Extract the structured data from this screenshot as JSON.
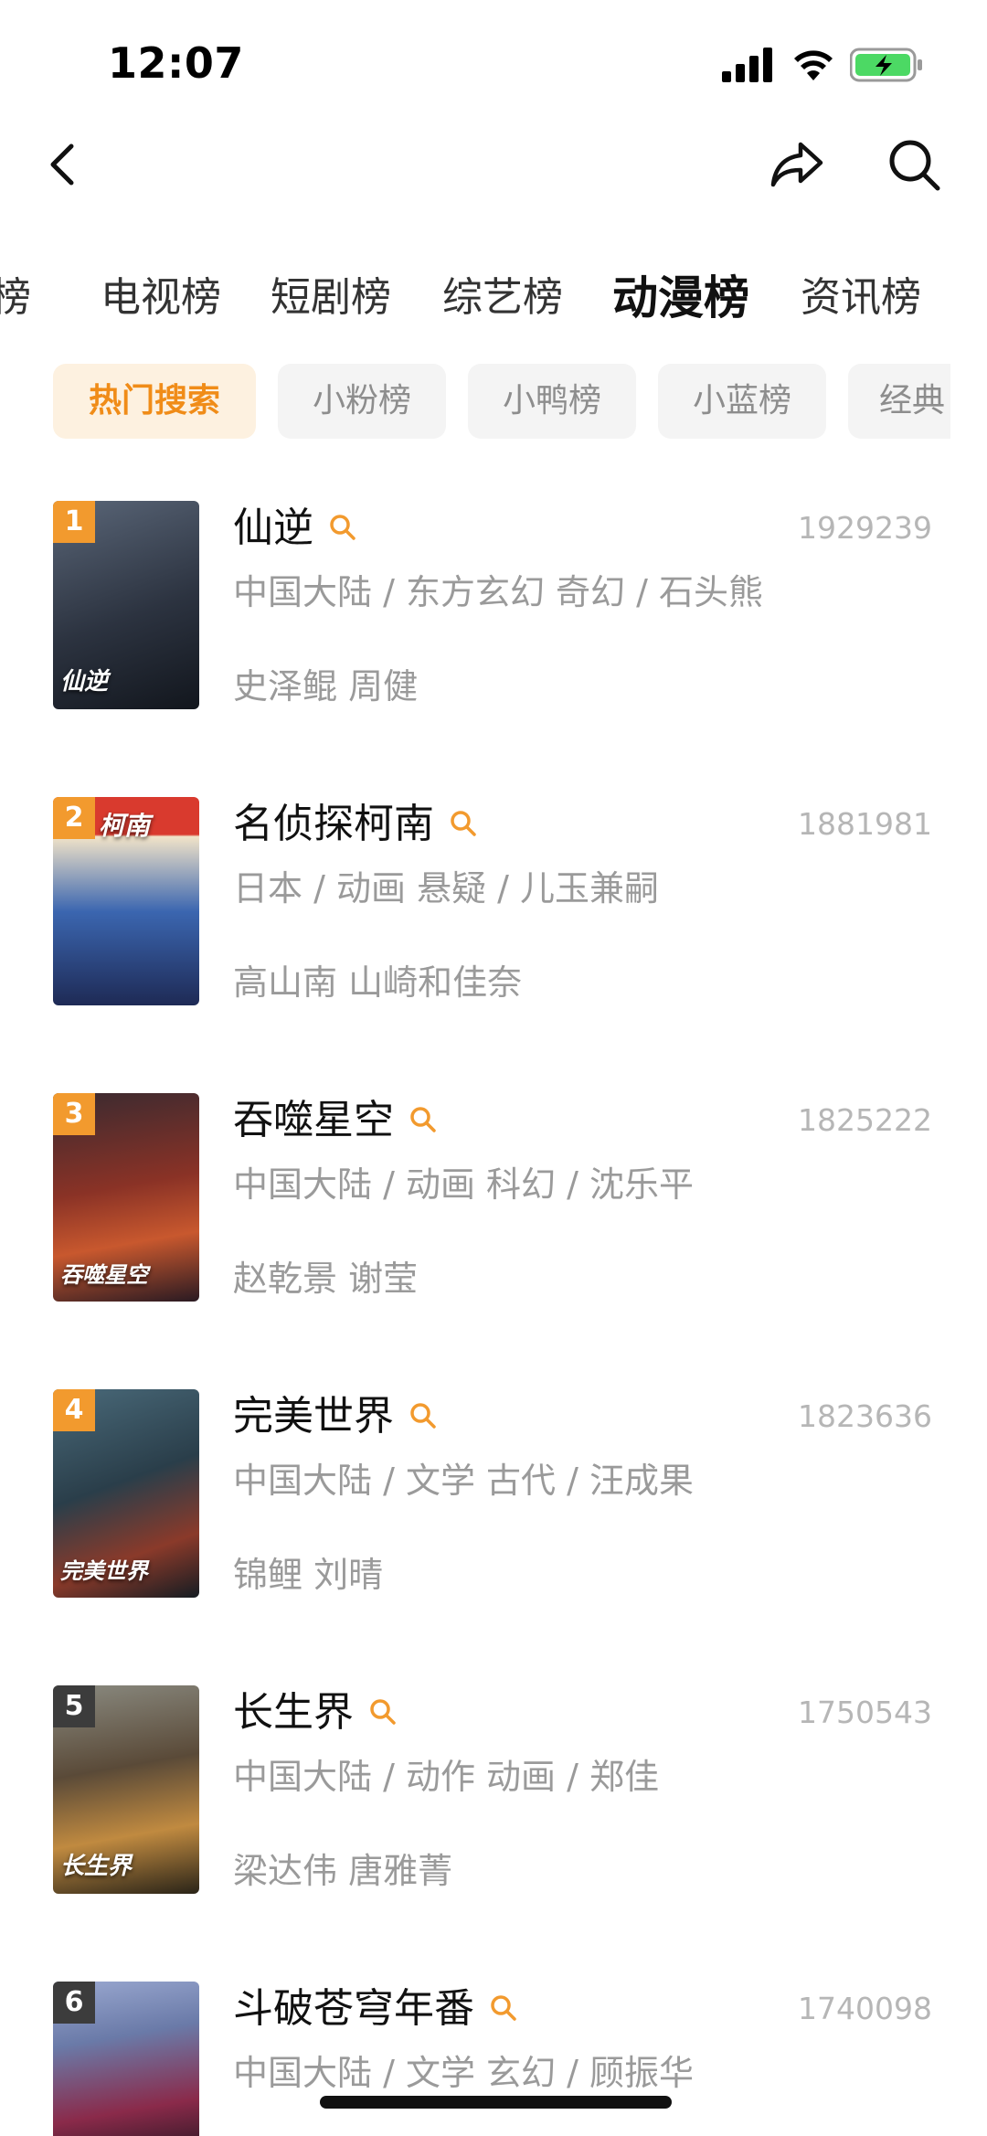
{
  "status_bar": {
    "time": "12:07"
  },
  "category_tabs": [
    {
      "label": "榜"
    },
    {
      "label": "电视榜"
    },
    {
      "label": "短剧榜"
    },
    {
      "label": "综艺榜"
    },
    {
      "label": "动漫榜",
      "active": true
    },
    {
      "label": "资讯榜"
    }
  ],
  "sub_tabs": [
    {
      "label": "热门搜索",
      "active": true
    },
    {
      "label": "小粉榜"
    },
    {
      "label": "小鸭榜"
    },
    {
      "label": "小蓝榜"
    },
    {
      "label": "经典"
    }
  ],
  "items": [
    {
      "rank": "1",
      "title": "仙逆",
      "count": "1929239",
      "meta": "中国大陆 / 东方玄幻 奇幻 / 石头熊",
      "cast": "史泽鲲 周健",
      "poster_text": "仙逆",
      "poster_colors": [
        "#4a5566",
        "#1f2430"
      ]
    },
    {
      "rank": "2",
      "title": "名侦探柯南",
      "count": "1881981",
      "meta": "日本 / 动画 悬疑 / 儿玉兼嗣",
      "cast": "高山南 山崎和佳奈",
      "poster_text": "柯南",
      "poster_colors": [
        "#d0302a",
        "#2a3a7a"
      ]
    },
    {
      "rank": "3",
      "title": "吞噬星空",
      "count": "1825222",
      "meta": "中国大陆 / 动画 科幻 / 沈乐平",
      "cast": "赵乾景 谢莹",
      "poster_text": "吞噬星空",
      "poster_colors": [
        "#8a2a20",
        "#2a1a22"
      ]
    },
    {
      "rank": "4",
      "title": "完美世界",
      "count": "1823636",
      "meta": "中国大陆 / 文学 古代 / 汪成果",
      "cast": "锦鲤 刘晴",
      "poster_text": "完美世界",
      "poster_colors": [
        "#2f4a5a",
        "#15202a"
      ]
    },
    {
      "rank": "5",
      "title": "长生界",
      "count": "1750543",
      "meta": "中国大陆 / 动作 动画 / 郑佳",
      "cast": "梁达伟 唐雅菁",
      "poster_text": "长生界",
      "poster_colors": [
        "#8a7a5a",
        "#2a2418"
      ]
    },
    {
      "rank": "6",
      "title": "斗破苍穹年番",
      "count": "1740098",
      "meta": "中国大陆 / 文学 玄幻 / 顾振华",
      "cast": "",
      "poster_text": "",
      "poster_colors": [
        "#6a7aa8",
        "#8a2a4a"
      ]
    }
  ]
}
